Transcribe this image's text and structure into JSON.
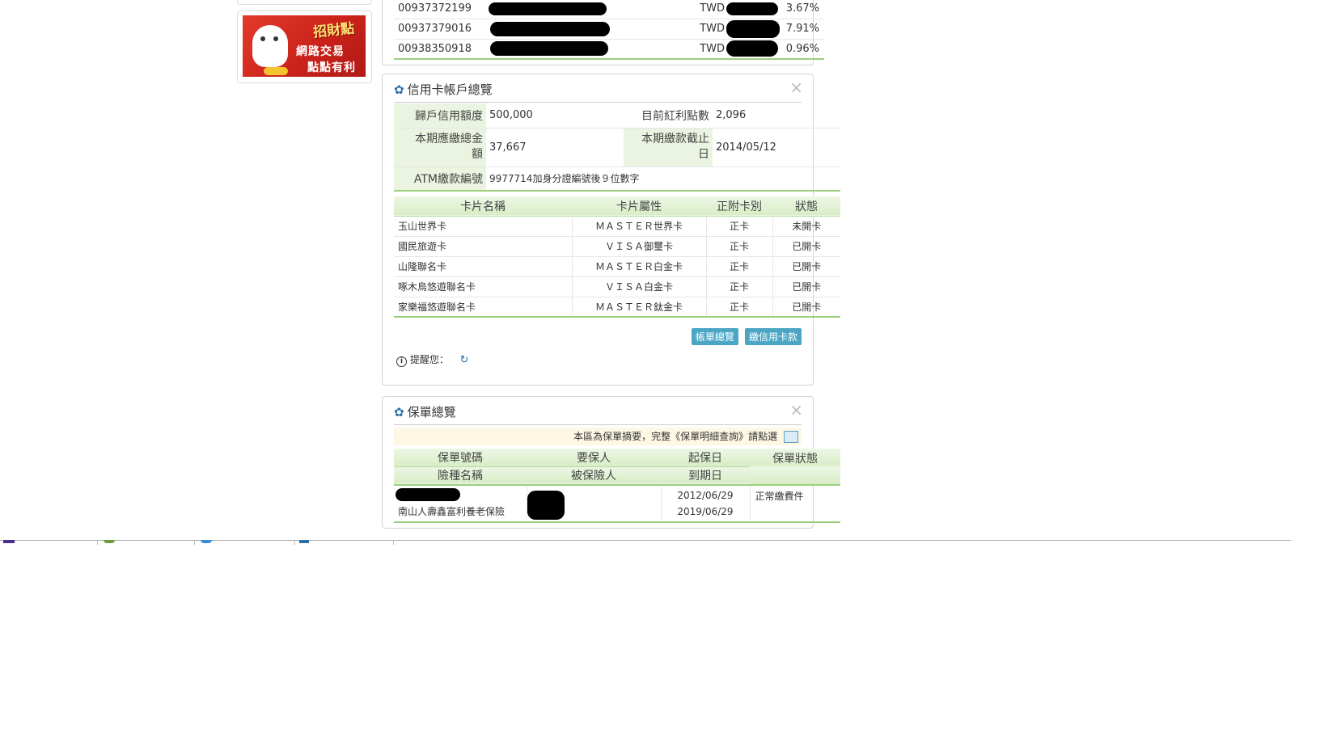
{
  "promo": {
    "badge": "招財點",
    "line1": "網路交易",
    "line2": "點點有利"
  },
  "funds": {
    "rows": [
      {
        "account": "00937372199",
        "currency": "TWD",
        "rate": "3.67%"
      },
      {
        "account": "00937379016",
        "currency": "TWD",
        "rate": "7.91%"
      },
      {
        "account": "00938350918",
        "currency": "TWD",
        "rate": "0.96%"
      }
    ]
  },
  "credit": {
    "title": "信用卡帳戶總覽",
    "close": "×",
    "limit_label": "歸戶信用額度",
    "limit_value": "500,000",
    "points_label": "目前紅利點數",
    "points_value": "2,096",
    "due_label_1": "本期應繳總金",
    "due_label_2": "額",
    "due_value": "37,667",
    "deadline_label_1": "本期繳款截止",
    "deadline_label_2": "日",
    "deadline_value": "2014/05/12",
    "atm_label": "ATM繳款編號",
    "atm_value": "9977714加身分證編號後９位數字",
    "columns": [
      "卡片名稱",
      "卡片屬性",
      "正附卡別",
      "狀態"
    ],
    "cards": [
      {
        "name": "玉山世界卡",
        "attr": "ＭＡＳＴＥＲ世界卡",
        "type": "正卡",
        "status": "未開卡"
      },
      {
        "name": "國民旅遊卡",
        "attr": "ＶＩＳＡ御璽卡",
        "type": "正卡",
        "status": "已開卡"
      },
      {
        "name": "山隆聯名卡",
        "attr": "ＭＡＳＴＥＲ白金卡",
        "type": "正卡",
        "status": "已開卡"
      },
      {
        "name": "啄木鳥悠遊聯名卡",
        "attr": "ＶＩＳＡ白金卡",
        "type": "正卡",
        "status": "已開卡"
      },
      {
        "name": "家樂福悠遊聯名卡",
        "attr": "ＭＡＳＴＥＲ鈦金卡",
        "type": "正卡",
        "status": "已開卡"
      }
    ],
    "btn_statement": "帳單總覽",
    "btn_pay": "繳信用卡款",
    "reminder": "提醒您："
  },
  "policy": {
    "title": "保單總覽",
    "close": "×",
    "notice": "本區為保單摘要，完整《保單明細查詢》請點選",
    "col_number": "保單號碼",
    "col_applicant": "要保人",
    "col_start": "起保日",
    "col_status": "保單狀態",
    "col_kind": "險種名稱",
    "col_insured": "被保險人",
    "col_end": "到期日",
    "row": {
      "kind": "南山人壽鑫富利養老保險",
      "start": "2012/06/29",
      "end": "2019/06/29",
      "status": "正常繳費件"
    }
  },
  "colors": {
    "header_green": "#d8edc6",
    "line_green": "#9ccf7d",
    "button_blue": "#4aa6c4",
    "gear_blue": "#2a6fa8"
  }
}
